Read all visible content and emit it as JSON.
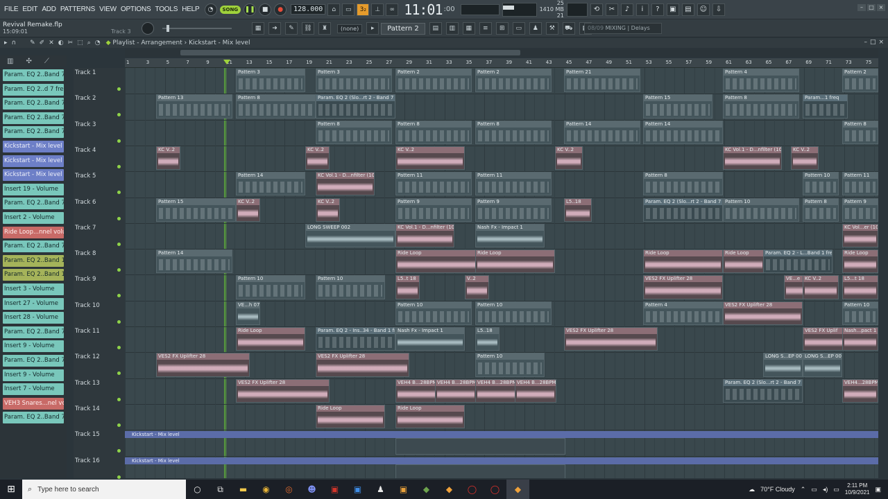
{
  "menu": [
    "FILE",
    "EDIT",
    "ADD",
    "PATTERNS",
    "VIEW",
    "OPTIONS",
    "TOOLS",
    "HELP"
  ],
  "transport": {
    "song_label": "SONG",
    "tempo": "128.000"
  },
  "clock": {
    "main": "11:01",
    "sub": ":00"
  },
  "stats": {
    "cpu": "25",
    "mem": "1410 MB",
    "poly": "21",
    "cpu_fraction": 0.35
  },
  "project": {
    "name": "Revival Remake.flp",
    "time": "15:09:01",
    "hint": "Track 3"
  },
  "pattern": {
    "none": "(none)",
    "current": "Pattern 2"
  },
  "hint_bar": {
    "num": "08/09",
    "text": "MIXING | Delays"
  },
  "playlist": {
    "prefix": "Playlist - Arrangement",
    "sep": "›",
    "suffix": "Kickstart - Mix level"
  },
  "ruler": [
    "1",
    "3",
    "5",
    "7",
    "9",
    "11",
    "13",
    "15",
    "17",
    "19",
    "21",
    "23",
    "25",
    "27",
    "29",
    "31",
    "33",
    "35",
    "37",
    "39",
    "41",
    "43",
    "45",
    "47",
    "49",
    "51",
    "53",
    "55",
    "57",
    "59",
    "61",
    "63",
    "65",
    "67",
    "69",
    "71",
    "73",
    "75"
  ],
  "sidebar": [
    {
      "label": "Param. EQ 2..Band 7 freq",
      "color": "teal"
    },
    {
      "label": "Param. EQ 2..d 7 freq #2",
      "color": "teal"
    },
    {
      "label": "Param. EQ 2..Band 7 freq",
      "color": "teal"
    },
    {
      "label": "Param. EQ 2..Band 7 freq",
      "color": "teal"
    },
    {
      "label": "Param. EQ 2..Band 7 freq",
      "color": "teal"
    },
    {
      "label": "Kickstart - Mix level",
      "color": "blue"
    },
    {
      "label": "Kickstart - Mix level",
      "color": "blue"
    },
    {
      "label": "Kickstart - Mix level",
      "color": "blue"
    },
    {
      "label": "Insert 19 - Volume",
      "color": "teal"
    },
    {
      "label": "Param. EQ 2..Band 7 freq",
      "color": "teal"
    },
    {
      "label": "Insert 2 - Volume",
      "color": "teal"
    },
    {
      "label": "Ride Loop...nnel volume",
      "color": "red"
    },
    {
      "label": "Param. EQ 2..Band 7 freq",
      "color": "teal"
    },
    {
      "label": "Param. EQ 2..Band 1 freq",
      "color": "olive"
    },
    {
      "label": "Param. EQ 2..Band 1 freq",
      "color": "olive"
    },
    {
      "label": "Insert 3 - Volume",
      "color": "teal"
    },
    {
      "label": "Insert 27 - Volume",
      "color": "teal"
    },
    {
      "label": "Insert 28 - Volume",
      "color": "teal"
    },
    {
      "label": "Param. EQ 2..Band 7 freq",
      "color": "teal"
    },
    {
      "label": "Insert 9 - Volume",
      "color": "teal"
    },
    {
      "label": "Param. EQ 2..Band 7 freq",
      "color": "teal"
    },
    {
      "label": "Insert 9 - Volume",
      "color": "teal"
    },
    {
      "label": "Insert 7 - Volume",
      "color": "teal"
    },
    {
      "label": "VEH3 Snares...nel volume",
      "color": "red"
    },
    {
      "label": "Param. EQ 2..Band 7 freq",
      "color": "teal"
    }
  ],
  "tracks": [
    "Track 1",
    "Track 2",
    "Track 3",
    "Track 4",
    "Track 5",
    "Track 6",
    "Track 7",
    "Track 8",
    "Track 9",
    "Track 10",
    "Track 11",
    "Track 12",
    "Track 13",
    "Track 14",
    "Track 15",
    "Track 16"
  ],
  "clips": {
    "c1": "Pattern 3",
    "c2": "Pattern 3",
    "c3": "Pattern 2",
    "c4": "Pattern 2",
    "c5": "Pattern 21",
    "c6": "Pattern 4",
    "c7": "Pattern 2",
    "c8": "Pattern 13",
    "c9": "Pattern 8",
    "c10": "Param. EQ 2 (Slo...rt 2 - Band 7 freq",
    "c11": "Pattern 15",
    "c12": "Pattern 8",
    "c13": "Param...1 freq",
    "c14": "Pattern 8",
    "c15": "Pattern 8",
    "c16": "Pattern 8",
    "c17": "Pattern 14",
    "c18": "Pattern 14",
    "c19": "Pattern 8",
    "c20": "KC V..2",
    "c21": "KC V..2",
    "c22": "KC V..2",
    "c23": "KC V..2",
    "c24": "KC Vol.1 - D...nfilter (10)",
    "c25": "KC V..2",
    "c26": "Pattern 14",
    "c27": "KC Vol.1 - D...nfilter (10)",
    "c28": "Pattern 11",
    "c29": "Pattern 11",
    "c30": "Pattern 8",
    "c31": "Pattern 10",
    "c32": "Pattern 11",
    "c33": "Pattern 15",
    "c34": "KC V..2",
    "c35": "KC V..2",
    "c36": "Pattern 9",
    "c37": "Pattern 9",
    "c38": "L5..18",
    "c39": "Param. EQ 2 (Slo...rt 2 - Band 7 freq",
    "c40": "Pattern 10",
    "c41": "Pattern 8",
    "c42": "Pattern 9",
    "c43": "LONG SWEEP 002",
    "c44": "KC Vol.1 - D...nfilter (10)",
    "c45": "Nash Fx - Impact 1",
    "c46": "KC Vol...er (10)",
    "c47": "Pattern 14",
    "c48": "Ride Loop",
    "c49": "Ride Loop",
    "c50": "Ride Loop",
    "c51": "Ride Loop",
    "c52": "Param. EQ 2 - L...Band 1 freq",
    "c53": "Ride Loop",
    "c54": "Pattern 10",
    "c55": "Pattern 10",
    "c56": "L5..t 18",
    "c57": "V..2",
    "c58": "VES2 FX Uplifter 28",
    "c59": "VE...e",
    "c60": "KC V..2",
    "c61": "L5...t 18",
    "c62": "VE...h 07",
    "c63": "Pattern 10",
    "c64": "Pattern 10",
    "c65": "Pattern 4",
    "c66": "VES2 FX Uplifter 28",
    "c67": "Pattern 10",
    "c68": "Ride Loop",
    "c69": "Param. EQ 2 - Ins..34 - Band 1 freq",
    "c70": "Nash Fx - Impact 1",
    "c71": "L5..18",
    "c72": "VES2 FX Uplifter 28",
    "c73": "VES2 FX Uplif",
    "c74": "Nash...pact 1",
    "c75": "VES2 FX Uplifter 28",
    "c76": "VES2 FX Uplifter 28",
    "c77": "Pattern 10",
    "c78": "LONG S...EP 002",
    "c79": "LONG S...EP 002",
    "c80": "VES2 FX Uplifter 28",
    "c81": "VEH4 B...28BPM",
    "c82": "VEH4 B...28BPM",
    "c83": "VEH4 B...28BPM",
    "c84": "VEH4 B...28BPM",
    "c85": "Param. EQ 2 (Slo...rt 2 - Band 7 freq",
    "c86": "VEH4...28BPM",
    "c87": "Ride Loop",
    "c88": "Ride Loop",
    "c89": "Kickstart - Mix level",
    "c90": "Kickstart - Mix level"
  },
  "taskbar": {
    "search_placeholder": "Type here to search",
    "weather": "70°F  Cloudy",
    "time": "2:11 PM",
    "date": "10/9/2021"
  },
  "colors": {
    "accent_green": "#9fd23b",
    "record": "#e54c3a",
    "clip_pink": "#8c6e76",
    "automation_blue": "#5b6ca8"
  },
  "icons": [
    "record-icon",
    "play-icon",
    "stop-icon",
    "magnet-icon",
    "pencil-icon",
    "brush-icon",
    "delete-icon",
    "mute-icon",
    "slice-icon",
    "select-icon",
    "zoom-icon",
    "speaker-icon",
    "windows-icon",
    "search-icon"
  ]
}
